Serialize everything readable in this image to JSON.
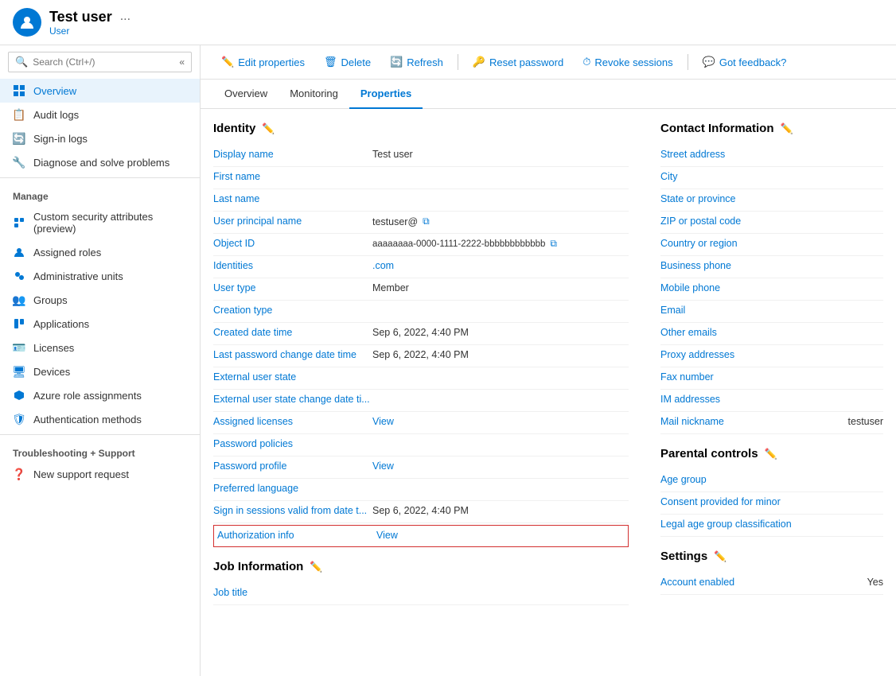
{
  "header": {
    "user_name": "Test user",
    "user_type": "User",
    "more_label": "..."
  },
  "toolbar": {
    "edit_label": "Edit properties",
    "delete_label": "Delete",
    "refresh_label": "Refresh",
    "reset_password_label": "Reset password",
    "revoke_sessions_label": "Revoke sessions",
    "feedback_label": "Got feedback?"
  },
  "tabs": {
    "overview": "Overview",
    "monitoring": "Monitoring",
    "properties": "Properties"
  },
  "sidebar": {
    "search_placeholder": "Search (Ctrl+/)",
    "items": [
      {
        "label": "Overview",
        "active": true
      },
      {
        "label": "Audit logs"
      },
      {
        "label": "Sign-in logs"
      },
      {
        "label": "Diagnose and solve problems"
      }
    ],
    "manage_label": "Manage",
    "manage_items": [
      {
        "label": "Custom security attributes (preview)"
      },
      {
        "label": "Assigned roles"
      },
      {
        "label": "Administrative units"
      },
      {
        "label": "Groups"
      },
      {
        "label": "Applications"
      },
      {
        "label": "Licenses"
      },
      {
        "label": "Devices"
      },
      {
        "label": "Azure role assignments"
      },
      {
        "label": "Authentication methods"
      }
    ],
    "support_label": "Troubleshooting + Support",
    "support_items": [
      {
        "label": "New support request"
      }
    ]
  },
  "identity": {
    "section_title": "Identity",
    "fields": [
      {
        "label": "Display name",
        "value": "Test user",
        "type": "text"
      },
      {
        "label": "First name",
        "value": "",
        "type": "text"
      },
      {
        "label": "Last name",
        "value": "",
        "type": "text"
      },
      {
        "label": "User principal name",
        "value": "testuser@",
        "type": "copy"
      },
      {
        "label": "Object ID",
        "value": "aaaaaaaa-0000-1111-2222-bbbbbbbbbbbb",
        "type": "copy"
      },
      {
        "label": "Identities",
        "value": ".com",
        "type": "link"
      },
      {
        "label": "User type",
        "value": "Member",
        "type": "text"
      },
      {
        "label": "Creation type",
        "value": "",
        "type": "text"
      },
      {
        "label": "Created date time",
        "value": "Sep 6, 2022, 4:40 PM",
        "type": "text"
      },
      {
        "label": "Last password change date time",
        "value": "Sep 6, 2022, 4:40 PM",
        "type": "text"
      },
      {
        "label": "External user state",
        "value": "",
        "type": "text"
      },
      {
        "label": "External user state change date ti...",
        "value": "",
        "type": "text"
      },
      {
        "label": "Assigned licenses",
        "value": "View",
        "type": "viewlink"
      },
      {
        "label": "Password policies",
        "value": "",
        "type": "text"
      },
      {
        "label": "Password profile",
        "value": "View",
        "type": "viewlink"
      },
      {
        "label": "Preferred language",
        "value": "",
        "type": "text"
      },
      {
        "label": "Sign in sessions valid from date t...",
        "value": "Sep 6, 2022, 4:40 PM",
        "type": "text"
      },
      {
        "label": "Authorization info",
        "value": "View",
        "type": "auth"
      }
    ]
  },
  "job_info": {
    "section_title": "Job Information",
    "fields": [
      {
        "label": "Job title",
        "value": "",
        "type": "text"
      }
    ]
  },
  "contact": {
    "section_title": "Contact Information",
    "fields": [
      {
        "label": "Street address",
        "value": ""
      },
      {
        "label": "City",
        "value": ""
      },
      {
        "label": "State or province",
        "value": ""
      },
      {
        "label": "ZIP or postal code",
        "value": ""
      },
      {
        "label": "Country or region",
        "value": ""
      },
      {
        "label": "Business phone",
        "value": ""
      },
      {
        "label": "Mobile phone",
        "value": ""
      },
      {
        "label": "Email",
        "value": ""
      },
      {
        "label": "Other emails",
        "value": ""
      },
      {
        "label": "Proxy addresses",
        "value": ""
      },
      {
        "label": "Fax number",
        "value": ""
      },
      {
        "label": "IM addresses",
        "value": ""
      },
      {
        "label": "Mail nickname",
        "value": "testuser"
      }
    ]
  },
  "parental_controls": {
    "section_title": "Parental controls",
    "fields": [
      {
        "label": "Age group",
        "value": ""
      },
      {
        "label": "Consent provided for minor",
        "value": ""
      },
      {
        "label": "Legal age group classification",
        "value": ""
      }
    ]
  },
  "settings": {
    "section_title": "Settings",
    "fields": [
      {
        "label": "Account enabled",
        "value": "Yes"
      }
    ]
  }
}
